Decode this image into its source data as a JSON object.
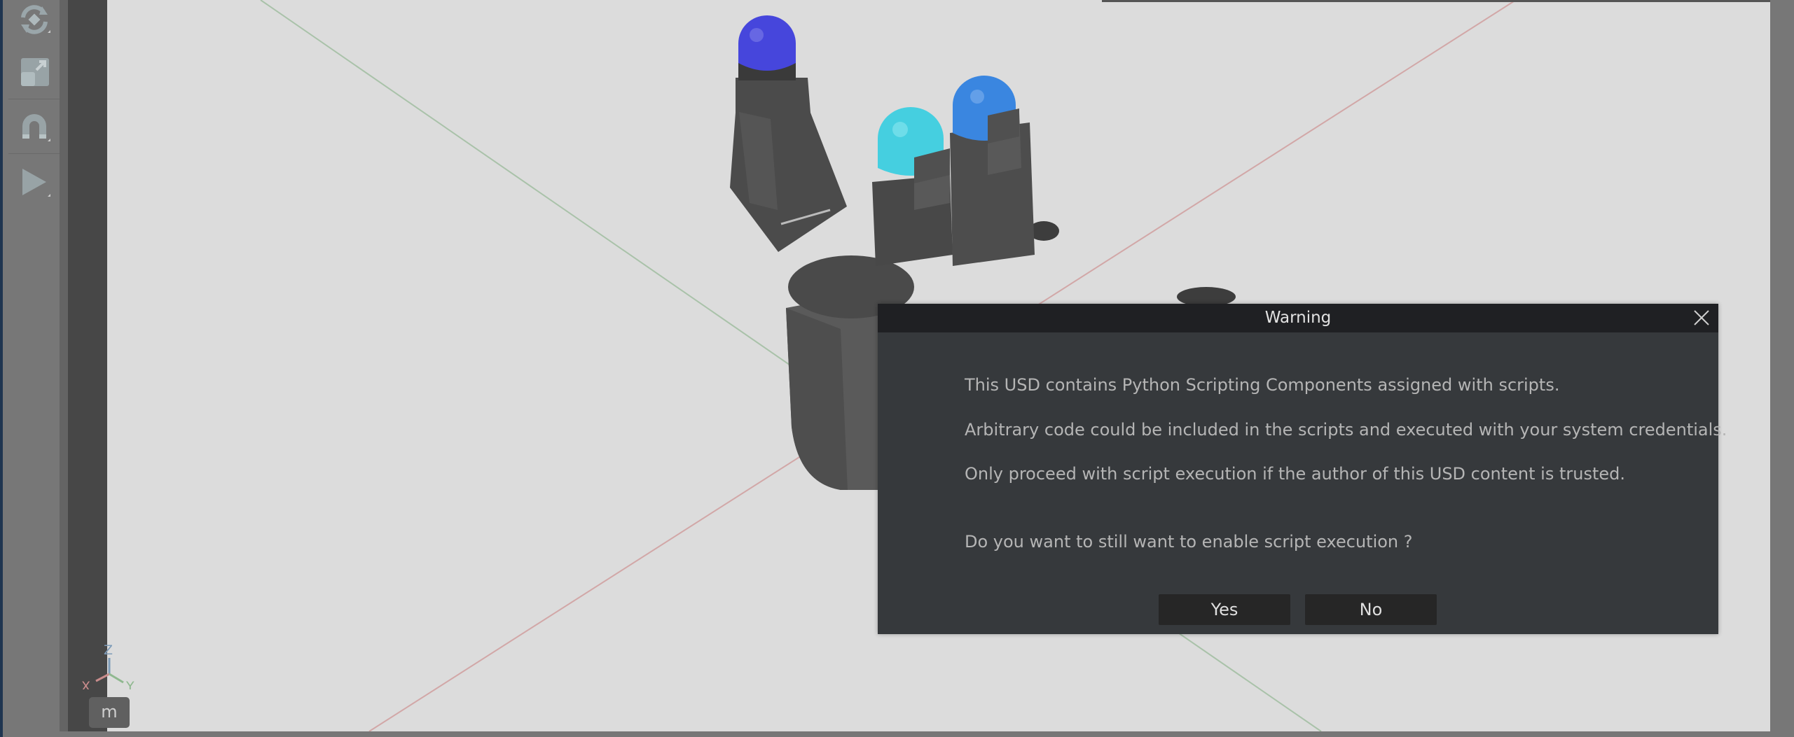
{
  "toolbar": {
    "tools": [
      {
        "icon": "rotate-icon"
      },
      {
        "icon": "scale-icon"
      },
      {
        "icon": "snap-magnet-icon"
      },
      {
        "icon": "play-icon"
      }
    ]
  },
  "viewport": {
    "axis_labels": {
      "x": "X",
      "y": "Y",
      "z": "Z"
    },
    "unit_label": "m",
    "colors": {
      "background": "#dcdcdc",
      "x_axis": "#c98c8c",
      "y_axis": "#8fb88f",
      "z_axis": "#7d9bb8",
      "tip_1": "#4646dc",
      "tip_2": "#45cfe0",
      "tip_3": "#3a86e0"
    }
  },
  "dialog": {
    "title": "Warning",
    "close_icon": "close-icon",
    "messages": [
      "This USD contains Python Scripting Components assigned with scripts.",
      "Arbitrary code could be included in the scripts and executed with your system credentials.",
      "Only proceed with script execution if the author of this USD content is trusted.",
      "Do you want to still want to enable script execution ?"
    ],
    "yes_label": "Yes",
    "no_label": "No"
  }
}
